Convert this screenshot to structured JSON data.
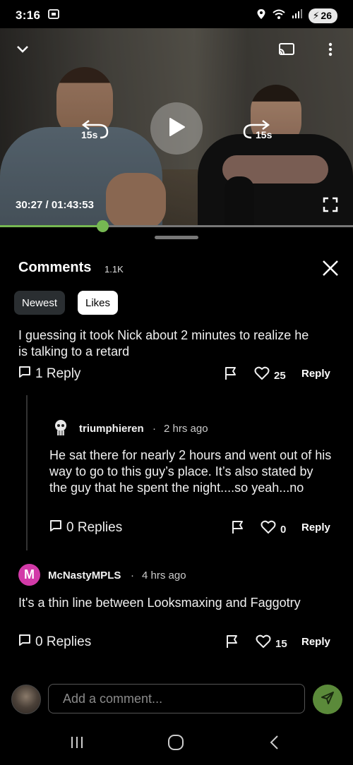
{
  "status_bar": {
    "time": "3:16",
    "battery": "26"
  },
  "video": {
    "seek_back_label": "15s",
    "seek_forward_label": "15s",
    "timecode": "30:27 / 01:43:53",
    "progress": 0.29,
    "accent_color": "#76b852"
  },
  "comments": {
    "title": "Comments",
    "count": "1.1K",
    "filters": [
      "Newest",
      "Likes"
    ],
    "active_filter": "Likes",
    "items": [
      {
        "text": "I guessing it took Nick about 2 minutes to realize he is talking to a retard",
        "replies_label": "1 Reply",
        "likes": "25",
        "reply_label": "Reply"
      },
      {
        "username": "triumphieren",
        "time_ago": "2 hrs ago",
        "text": "He sat there for nearly 2 hours and went out of his way to go to this guy’s place. It’s also stated by the guy that he spent the night....so yeah...no",
        "replies_label": "0 Replies",
        "likes": "0",
        "reply_label": "Reply"
      },
      {
        "avatar_letter": "M",
        "username": "McNastyMPLS",
        "time_ago": "4 hrs ago",
        "text": "It's a thin line between Looksmaxing and Faggotry",
        "replies_label": "0 Replies",
        "likes": "15",
        "reply_label": "Reply"
      }
    ]
  },
  "composer": {
    "placeholder": "Add a comment...",
    "send_color": "#5b8a3a"
  },
  "icons": [
    "chevron-down-icon",
    "cast-icon",
    "more-vert-icon",
    "replay-15-icon",
    "play-icon",
    "forward-15-icon",
    "fullscreen-icon",
    "close-icon",
    "comment-icon",
    "flag-icon",
    "heart-icon",
    "send-icon",
    "recents-icon",
    "home-icon",
    "back-icon"
  ]
}
